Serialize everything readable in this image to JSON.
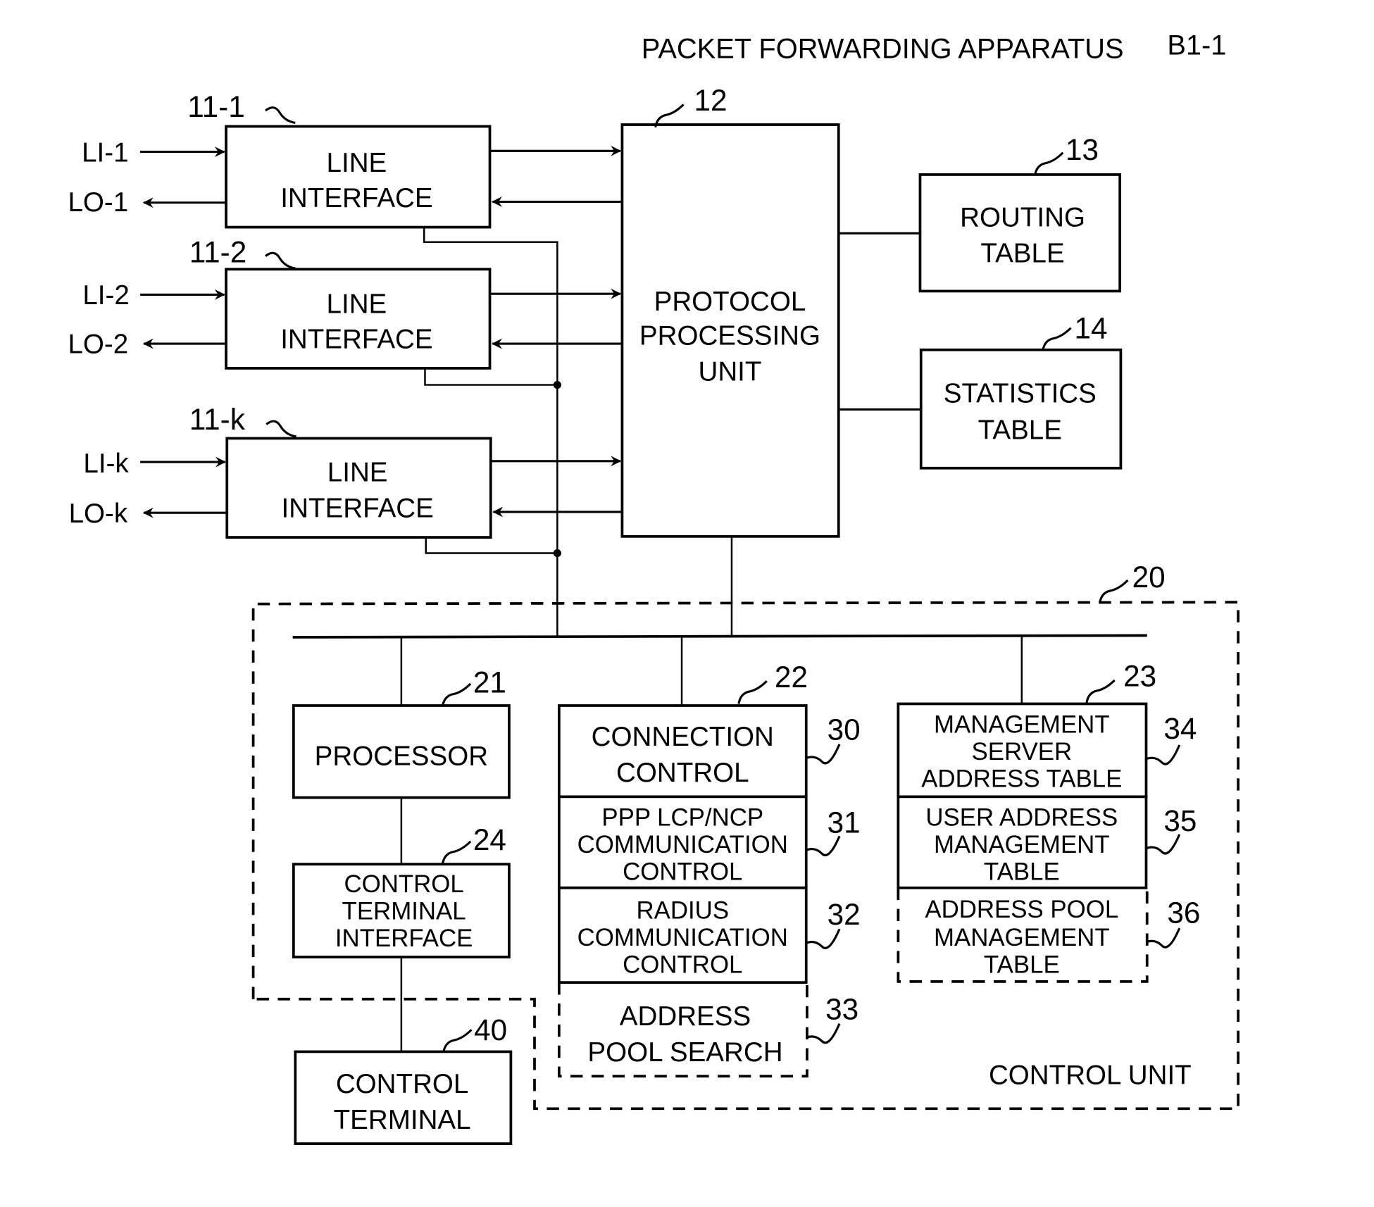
{
  "title": "PACKET FORWARDING APPARATUS",
  "title_ref": "B1-1",
  "line_interfaces": [
    {
      "ref": "11-1",
      "lines": [
        "LINE",
        "INTERFACE"
      ],
      "input": "LI-1",
      "output": "LO-1"
    },
    {
      "ref": "11-2",
      "lines": [
        "LINE",
        "INTERFACE"
      ],
      "input": "LI-2",
      "output": "LO-2"
    },
    {
      "ref": "11-k",
      "lines": [
        "LINE",
        "INTERFACE"
      ],
      "input": "LI-k",
      "output": "LO-k"
    }
  ],
  "protocol_processing_unit": {
    "ref": "12",
    "lines": [
      "PROTOCOL",
      "PROCESSING",
      "UNIT"
    ]
  },
  "routing_table": {
    "ref": "13",
    "lines": [
      "ROUTING",
      "TABLE"
    ]
  },
  "statistics_table": {
    "ref": "14",
    "lines": [
      "STATISTICS",
      "TABLE"
    ]
  },
  "control_unit": {
    "ref": "20",
    "label": "CONTROL UNIT",
    "processor": {
      "ref": "21",
      "lines": [
        "PROCESSOR"
      ]
    },
    "control_terminal_interface": {
      "ref": "24",
      "lines": [
        "CONTROL",
        "TERMINAL",
        "INTERFACE"
      ]
    },
    "connection_group": {
      "ref": "22",
      "items": [
        {
          "ref": "30",
          "lines": [
            "CONNECTION",
            "CONTROL"
          ]
        },
        {
          "ref": "31",
          "lines": [
            "PPP LCP/NCP",
            "COMMUNICATION",
            "CONTROL"
          ]
        },
        {
          "ref": "32",
          "lines": [
            "RADIUS",
            "COMMUNICATION",
            "CONTROL"
          ]
        },
        {
          "ref": "33",
          "lines": [
            "ADDRESS",
            "POOL SEARCH"
          ]
        }
      ]
    },
    "table_group": {
      "ref": "23",
      "items": [
        {
          "ref": "34",
          "lines": [
            "MANAGEMENT",
            "SERVER",
            "ADDRESS TABLE"
          ]
        },
        {
          "ref": "35",
          "lines": [
            "USER ADDRESS",
            "MANAGEMENT",
            "TABLE"
          ]
        },
        {
          "ref": "36",
          "lines": [
            "ADDRESS POOL",
            "MANAGEMENT",
            "TABLE"
          ]
        }
      ]
    }
  },
  "control_terminal": {
    "ref": "40",
    "lines": [
      "CONTROL",
      "TERMINAL"
    ]
  }
}
